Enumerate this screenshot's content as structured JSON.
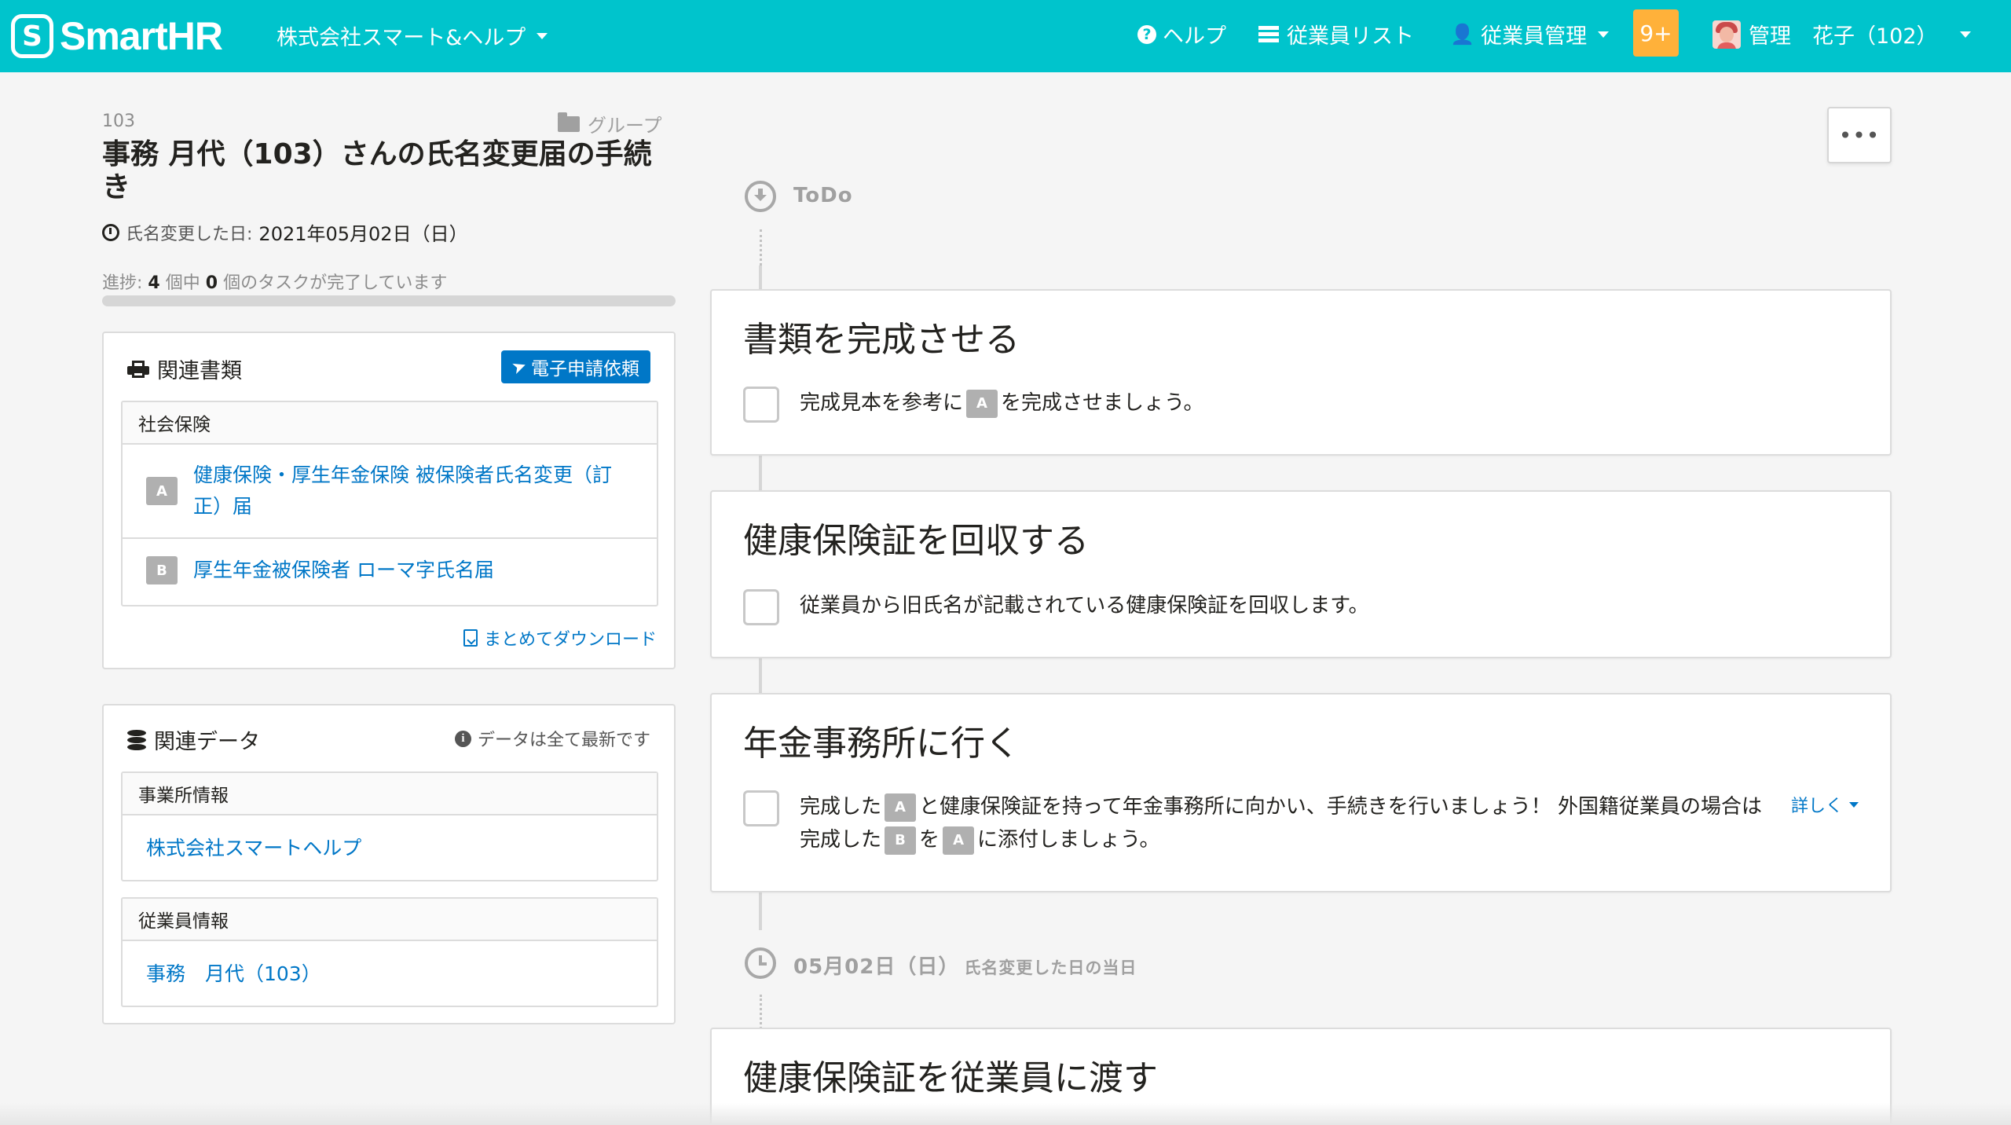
{
  "header": {
    "logo_text": "SmartHR",
    "logo_mark": "S",
    "company": "株式会社スマート&ヘルプ",
    "nav": {
      "help": "ヘルプ",
      "employee_list": "従業員リスト",
      "employee_mgmt": "従業員管理"
    },
    "notification_count": "9+",
    "user": "管理　花子（102）"
  },
  "procedure": {
    "number": "103",
    "group_label": "グループ",
    "title": "事務 月代（103）さんの氏名変更届の手続き",
    "date_label": "氏名変更した日:",
    "date_value": "2021年05月02日（日）",
    "progress": {
      "prefix": "進捗:",
      "total": "4",
      "mid": "個中",
      "done": "0",
      "suffix": "個のタスクが完了しています",
      "fraction": 0
    }
  },
  "related_docs": {
    "title": "関連書類",
    "efile_button": "電子申請依頼",
    "section": "社会保険",
    "items": [
      {
        "badge": "A",
        "label": "健康保険・厚生年金保険 被保険者氏名変更（訂正）届"
      },
      {
        "badge": "B",
        "label": "厚生年金被保険者 ローマ字氏名届"
      }
    ],
    "download_all": "まとめてダウンロード"
  },
  "related_data": {
    "title": "関連データ",
    "note": "データは全て最新です",
    "office_section": "事業所情報",
    "office_link": "株式会社スマートヘルプ",
    "employee_section": "従業員情報",
    "employee_link": "事務　月代（103）"
  },
  "more_button": "•••",
  "timeline": {
    "todo_label": "ToDo",
    "tasks": [
      {
        "title": "書類を完成させる",
        "text_1": "完成見本を参考に",
        "tag_1": "A",
        "text_2": "を完成させましょう。"
      },
      {
        "title": "健康保険証を回収する",
        "text": "従業員から旧氏名が記載されている健康保険証を回収します。"
      },
      {
        "title": "年金事務所に行く",
        "text_1": "完成した",
        "tag_1": "A",
        "text_2": "と健康保険証を持って年金事務所に向かい、手続きを行いましょう！ 外国籍従業員の場合は完成した",
        "tag_2": "B",
        "text_3": "を",
        "tag_3": "A",
        "text_4": "に添付しましょう。",
        "detail": "詳しく"
      }
    ],
    "date_marker": {
      "date": "05月02日（日）",
      "note": "氏名変更した日の当日"
    },
    "next_task_title": "健康保険証を従業員に渡す"
  }
}
